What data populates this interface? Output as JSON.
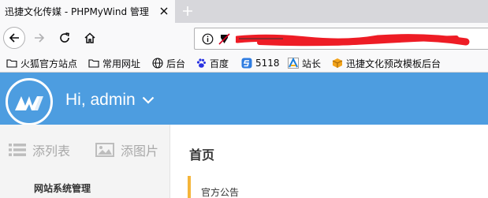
{
  "browser": {
    "tab_title": "迅捷文化传媒 - PHPMyWind 管理",
    "url_display": "",
    "bookmarks": [
      {
        "label": "火狐官方站点",
        "icon": "folder-icon"
      },
      {
        "label": "常用网址",
        "icon": "folder-icon"
      },
      {
        "label": "后台",
        "icon": "globe-icon"
      },
      {
        "label": "百度",
        "icon": "baidu-paw-icon"
      },
      {
        "label": "5118",
        "icon": "s5118-icon"
      },
      {
        "label": "站长",
        "icon": "chinaz-icon"
      },
      {
        "label": "迅捷文化预改模板后台",
        "icon": "cube-icon"
      }
    ]
  },
  "header": {
    "logo_text": "MW",
    "greeting": "Hi, admin"
  },
  "sidebar": {
    "quick_actions": [
      {
        "label": "添列表",
        "icon": "list-icon"
      },
      {
        "label": "添图片",
        "icon": "image-icon"
      }
    ],
    "section_title": "网站系统管理"
  },
  "main": {
    "page_title": "首页",
    "notice_title": "官方公告"
  },
  "colors": {
    "header_blue": "#4d9de0",
    "notice_accent": "#f5b53a",
    "redaction_red": "#ee1c25"
  }
}
